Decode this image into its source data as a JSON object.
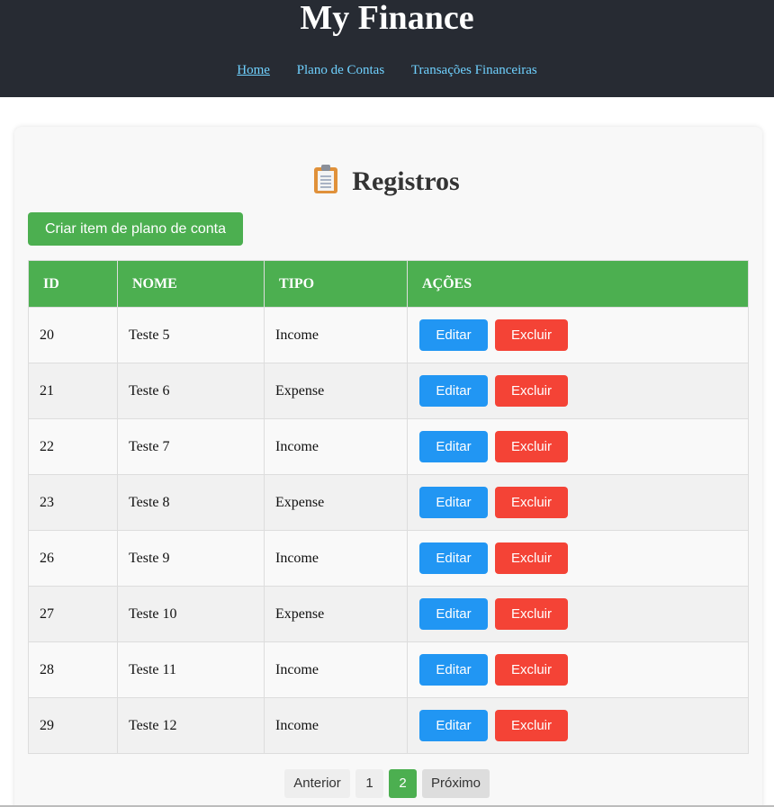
{
  "header": {
    "title": "My Finance",
    "nav": [
      {
        "label": "Home",
        "active": true
      },
      {
        "label": "Plano de Contas",
        "active": false
      },
      {
        "label": "Transações Financeiras",
        "active": false
      }
    ]
  },
  "main": {
    "title": "Registros",
    "title_icon": "clipboard-icon",
    "create_label": "Criar item de plano de conta",
    "columns": [
      "ID",
      "NOME",
      "TIPO",
      "AÇÕES"
    ],
    "rows": [
      {
        "id": "20",
        "nome": "Teste 5",
        "tipo": "Income"
      },
      {
        "id": "21",
        "nome": "Teste 6",
        "tipo": "Expense"
      },
      {
        "id": "22",
        "nome": "Teste 7",
        "tipo": "Income"
      },
      {
        "id": "23",
        "nome": "Teste 8",
        "tipo": "Expense"
      },
      {
        "id": "26",
        "nome": "Teste 9",
        "tipo": "Income"
      },
      {
        "id": "27",
        "nome": "Teste 10",
        "tipo": "Expense"
      },
      {
        "id": "28",
        "nome": "Teste 11",
        "tipo": "Income"
      },
      {
        "id": "29",
        "nome": "Teste 12",
        "tipo": "Income"
      }
    ],
    "edit_label": "Editar",
    "delete_label": "Excluir"
  },
  "pagination": {
    "prev_label": "Anterior",
    "pages": [
      "1",
      "2"
    ],
    "current_page": "2",
    "next_label": "Próximo"
  },
  "colors": {
    "header_bg": "#272b33",
    "nav_link": "#6fd1ff",
    "accent_green": "#4caf50",
    "edit_blue": "#2196f3",
    "delete_red": "#f44336"
  }
}
